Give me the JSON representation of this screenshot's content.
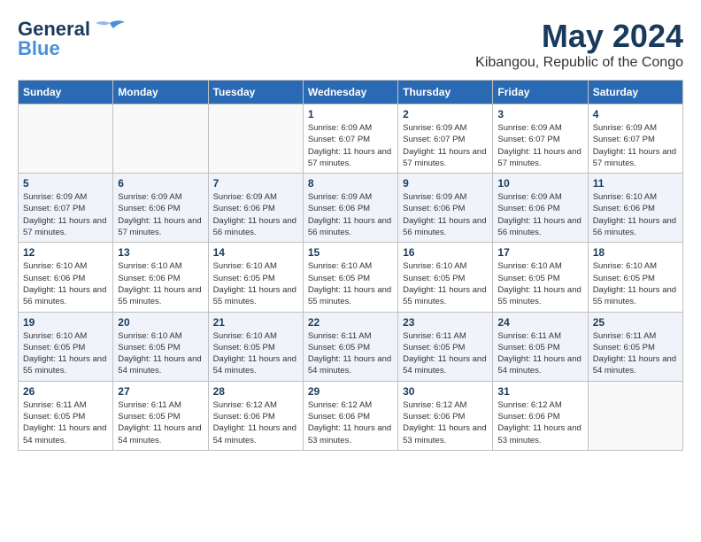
{
  "header": {
    "logo_line1": "General",
    "logo_line2": "Blue",
    "month_year": "May 2024",
    "location": "Kibangou, Republic of the Congo"
  },
  "weekdays": [
    "Sunday",
    "Monday",
    "Tuesday",
    "Wednesday",
    "Thursday",
    "Friday",
    "Saturday"
  ],
  "weeks": [
    [
      {
        "day": "",
        "info": ""
      },
      {
        "day": "",
        "info": ""
      },
      {
        "day": "",
        "info": ""
      },
      {
        "day": "1",
        "info": "Sunrise: 6:09 AM\nSunset: 6:07 PM\nDaylight: 11 hours and 57 minutes."
      },
      {
        "day": "2",
        "info": "Sunrise: 6:09 AM\nSunset: 6:07 PM\nDaylight: 11 hours and 57 minutes."
      },
      {
        "day": "3",
        "info": "Sunrise: 6:09 AM\nSunset: 6:07 PM\nDaylight: 11 hours and 57 minutes."
      },
      {
        "day": "4",
        "info": "Sunrise: 6:09 AM\nSunset: 6:07 PM\nDaylight: 11 hours and 57 minutes."
      }
    ],
    [
      {
        "day": "5",
        "info": "Sunrise: 6:09 AM\nSunset: 6:07 PM\nDaylight: 11 hours and 57 minutes."
      },
      {
        "day": "6",
        "info": "Sunrise: 6:09 AM\nSunset: 6:06 PM\nDaylight: 11 hours and 57 minutes."
      },
      {
        "day": "7",
        "info": "Sunrise: 6:09 AM\nSunset: 6:06 PM\nDaylight: 11 hours and 56 minutes."
      },
      {
        "day": "8",
        "info": "Sunrise: 6:09 AM\nSunset: 6:06 PM\nDaylight: 11 hours and 56 minutes."
      },
      {
        "day": "9",
        "info": "Sunrise: 6:09 AM\nSunset: 6:06 PM\nDaylight: 11 hours and 56 minutes."
      },
      {
        "day": "10",
        "info": "Sunrise: 6:09 AM\nSunset: 6:06 PM\nDaylight: 11 hours and 56 minutes."
      },
      {
        "day": "11",
        "info": "Sunrise: 6:10 AM\nSunset: 6:06 PM\nDaylight: 11 hours and 56 minutes."
      }
    ],
    [
      {
        "day": "12",
        "info": "Sunrise: 6:10 AM\nSunset: 6:06 PM\nDaylight: 11 hours and 56 minutes."
      },
      {
        "day": "13",
        "info": "Sunrise: 6:10 AM\nSunset: 6:06 PM\nDaylight: 11 hours and 55 minutes."
      },
      {
        "day": "14",
        "info": "Sunrise: 6:10 AM\nSunset: 6:05 PM\nDaylight: 11 hours and 55 minutes."
      },
      {
        "day": "15",
        "info": "Sunrise: 6:10 AM\nSunset: 6:05 PM\nDaylight: 11 hours and 55 minutes."
      },
      {
        "day": "16",
        "info": "Sunrise: 6:10 AM\nSunset: 6:05 PM\nDaylight: 11 hours and 55 minutes."
      },
      {
        "day": "17",
        "info": "Sunrise: 6:10 AM\nSunset: 6:05 PM\nDaylight: 11 hours and 55 minutes."
      },
      {
        "day": "18",
        "info": "Sunrise: 6:10 AM\nSunset: 6:05 PM\nDaylight: 11 hours and 55 minutes."
      }
    ],
    [
      {
        "day": "19",
        "info": "Sunrise: 6:10 AM\nSunset: 6:05 PM\nDaylight: 11 hours and 55 minutes."
      },
      {
        "day": "20",
        "info": "Sunrise: 6:10 AM\nSunset: 6:05 PM\nDaylight: 11 hours and 54 minutes."
      },
      {
        "day": "21",
        "info": "Sunrise: 6:10 AM\nSunset: 6:05 PM\nDaylight: 11 hours and 54 minutes."
      },
      {
        "day": "22",
        "info": "Sunrise: 6:11 AM\nSunset: 6:05 PM\nDaylight: 11 hours and 54 minutes."
      },
      {
        "day": "23",
        "info": "Sunrise: 6:11 AM\nSunset: 6:05 PM\nDaylight: 11 hours and 54 minutes."
      },
      {
        "day": "24",
        "info": "Sunrise: 6:11 AM\nSunset: 6:05 PM\nDaylight: 11 hours and 54 minutes."
      },
      {
        "day": "25",
        "info": "Sunrise: 6:11 AM\nSunset: 6:05 PM\nDaylight: 11 hours and 54 minutes."
      }
    ],
    [
      {
        "day": "26",
        "info": "Sunrise: 6:11 AM\nSunset: 6:05 PM\nDaylight: 11 hours and 54 minutes."
      },
      {
        "day": "27",
        "info": "Sunrise: 6:11 AM\nSunset: 6:05 PM\nDaylight: 11 hours and 54 minutes."
      },
      {
        "day": "28",
        "info": "Sunrise: 6:12 AM\nSunset: 6:06 PM\nDaylight: 11 hours and 54 minutes."
      },
      {
        "day": "29",
        "info": "Sunrise: 6:12 AM\nSunset: 6:06 PM\nDaylight: 11 hours and 53 minutes."
      },
      {
        "day": "30",
        "info": "Sunrise: 6:12 AM\nSunset: 6:06 PM\nDaylight: 11 hours and 53 minutes."
      },
      {
        "day": "31",
        "info": "Sunrise: 6:12 AM\nSunset: 6:06 PM\nDaylight: 11 hours and 53 minutes."
      },
      {
        "day": "",
        "info": ""
      }
    ]
  ]
}
